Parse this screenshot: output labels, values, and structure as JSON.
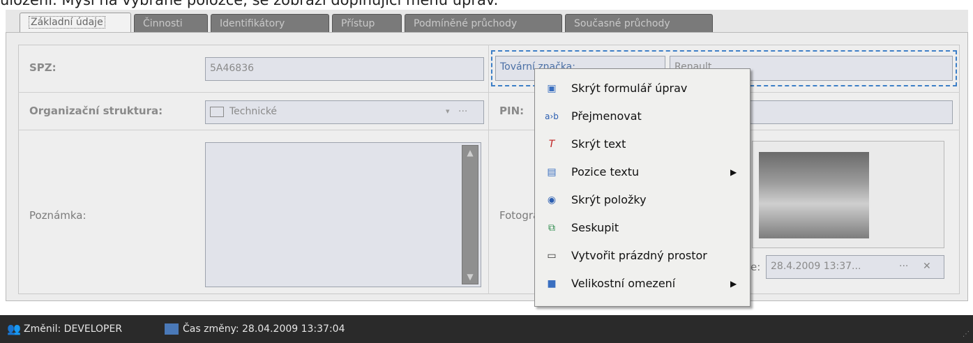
{
  "caption": "uložení. Myší na vybrané položce, se zobrazí doplňující menu úprav.",
  "tabs": [
    {
      "label": "Základní údaje",
      "active": true
    },
    {
      "label": "Činnosti",
      "active": false
    },
    {
      "label": "Identifikátory",
      "active": false
    },
    {
      "label": "Přístup",
      "active": false
    },
    {
      "label": "Podmíněné průchody",
      "active": false
    },
    {
      "label": "Současné průchody",
      "active": false
    }
  ],
  "form": {
    "spz_label": "SPZ:",
    "spz_value": "5A46836",
    "factory_label": "Tovární značka:",
    "factory_value": "Renault",
    "org_label": "Organizační struktura:",
    "org_value": "Technické",
    "pin_label": "PIN:",
    "note_label": "Poznámka:",
    "photo_label": "Fotografie:",
    "date_label_suffix": "e:",
    "date_value": "28.4.2009 13:37...",
    "date_more": "···",
    "date_clear": "✕",
    "org_more": "···"
  },
  "context_menu": {
    "items": [
      {
        "label": "Skrýt formulář úprav",
        "icon": "hide-form-icon",
        "glyph": "▣",
        "submenu": false
      },
      {
        "label": "Přejmenovat",
        "icon": "rename-icon",
        "glyph": "a›b",
        "submenu": false
      },
      {
        "label": "Skrýt text",
        "icon": "hide-text-icon",
        "glyph": "T",
        "submenu": false
      },
      {
        "label": "Pozice textu",
        "icon": "text-position-icon",
        "glyph": "▤",
        "submenu": true
      },
      {
        "label": "Skrýt položky",
        "icon": "hide-items-icon",
        "glyph": "◉",
        "submenu": false
      },
      {
        "label": "Seskupit",
        "icon": "group-icon",
        "glyph": "⧉",
        "submenu": false
      },
      {
        "label": "Vytvořit prázdný prostor",
        "icon": "empty-space-icon",
        "glyph": "▭",
        "submenu": false
      },
      {
        "label": "Velikostní omezení",
        "icon": "size-constraint-icon",
        "glyph": "■",
        "submenu": true
      }
    ]
  },
  "statusbar": {
    "changed_by": "Změnil: DEVELOPER",
    "changed_time": "Čas změny: 28.04.2009 13:37:04"
  },
  "colors": {
    "focus_border": "#3d7fc7",
    "menu_bg": "#f0f0ee",
    "statusbar_bg": "#2a2a2a"
  }
}
